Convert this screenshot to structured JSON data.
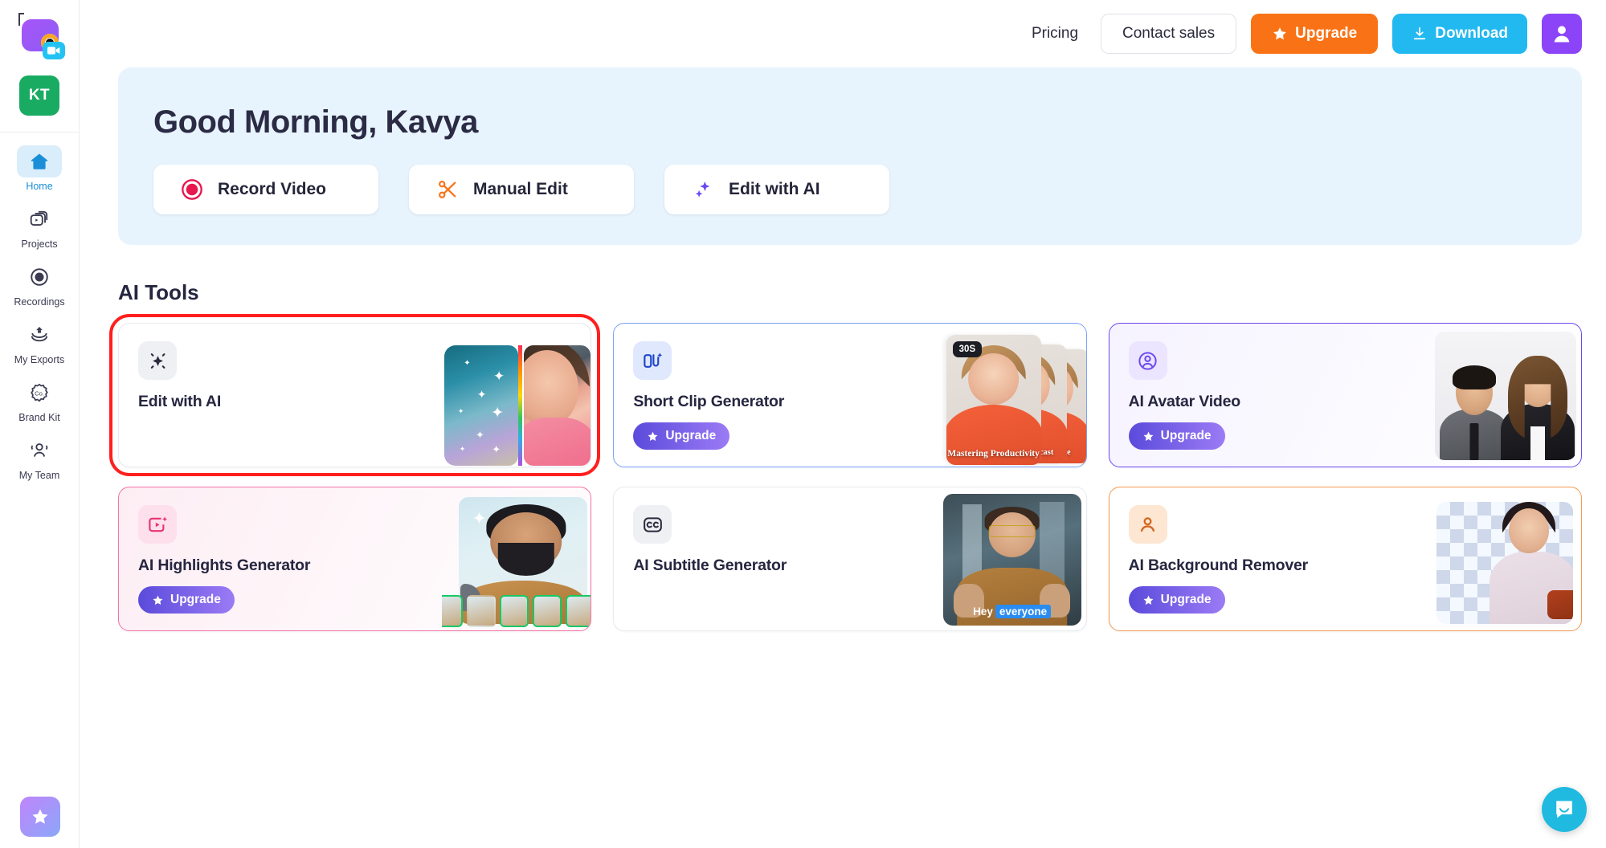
{
  "sidebar": {
    "logo_icon": "camera-logo-icon",
    "workspace": {
      "initials": "KT",
      "name": "workspace-badge"
    },
    "items": [
      {
        "label": "Home",
        "icon": "home-icon",
        "active": true
      },
      {
        "label": "Projects",
        "icon": "projects-icon",
        "active": false
      },
      {
        "label": "Recordings",
        "icon": "recordings-icon",
        "active": false
      },
      {
        "label": "My Exports",
        "icon": "exports-icon",
        "active": false
      },
      {
        "label": "Brand Kit",
        "icon": "brand-kit-icon",
        "active": false
      },
      {
        "label": "My Team",
        "icon": "team-icon",
        "active": false
      }
    ],
    "bottom_action": {
      "label": "",
      "icon": "star-icon"
    }
  },
  "topbar": {
    "pricing_label": "Pricing",
    "contact_sales_label": "Contact sales",
    "upgrade_label": "Upgrade",
    "upgrade_icon": "star-icon",
    "upgrade_color": "#f97316",
    "download_label": "Download",
    "download_icon": "download-icon",
    "download_color": "#22b8f0",
    "account_icon": "user-avatar-icon",
    "account_color": "#8b44f7"
  },
  "hero": {
    "greeting": "Good Morning, Kavya",
    "background_color": "#e8f4fd",
    "actions": [
      {
        "label": "Record Video",
        "icon": "record-circle-icon",
        "color": "#e8174e"
      },
      {
        "label": "Manual Edit",
        "icon": "scissors-icon",
        "color": "#f97316"
      },
      {
        "label": "Edit with AI",
        "icon": "sparkle-icon",
        "color": "#6d49f0"
      }
    ]
  },
  "ai_tools": {
    "section_title": "AI Tools",
    "cards": [
      {
        "title": "Edit with AI",
        "icon": "ai-sparkle-icon",
        "upgrade": null,
        "selected": true,
        "variant": "plain",
        "thumb": "edit-with-ai-thumbnail"
      },
      {
        "title": "Short Clip Generator",
        "icon": "short-clip-icon",
        "upgrade": "Upgrade",
        "selected": false,
        "variant": "blue",
        "thumb": "short-clip-thumbnail",
        "thumb_badge": "30S",
        "thumb_captions": [
          "Mastering Productivity",
          "This Podcast",
          "day's ode"
        ]
      },
      {
        "title": "AI Avatar Video",
        "icon": "avatar-user-icon",
        "upgrade": "Upgrade",
        "selected": false,
        "variant": "violet",
        "thumb": "ai-avatar-thumbnail"
      },
      {
        "title": "AI Highlights Generator",
        "icon": "highlights-play-icon",
        "upgrade": "Upgrade",
        "selected": false,
        "variant": "pink",
        "thumb": "ai-highlights-thumbnail"
      },
      {
        "title": "AI Subtitle Generator",
        "icon": "closed-caption-icon",
        "upgrade": null,
        "selected": false,
        "variant": "plain",
        "thumb": "ai-subtitle-thumbnail",
        "caption_plain": "Hey",
        "caption_highlight": "everyone"
      },
      {
        "title": "AI Background Remover",
        "icon": "background-remover-icon",
        "upgrade": "Upgrade",
        "selected": false,
        "variant": "orange",
        "thumb": "background-remover-thumbnail"
      }
    ],
    "upgrade_badge_icon": "star-icon"
  },
  "chat_widget": {
    "icon": "intercom-chat-icon",
    "color": "#20b9e0"
  }
}
